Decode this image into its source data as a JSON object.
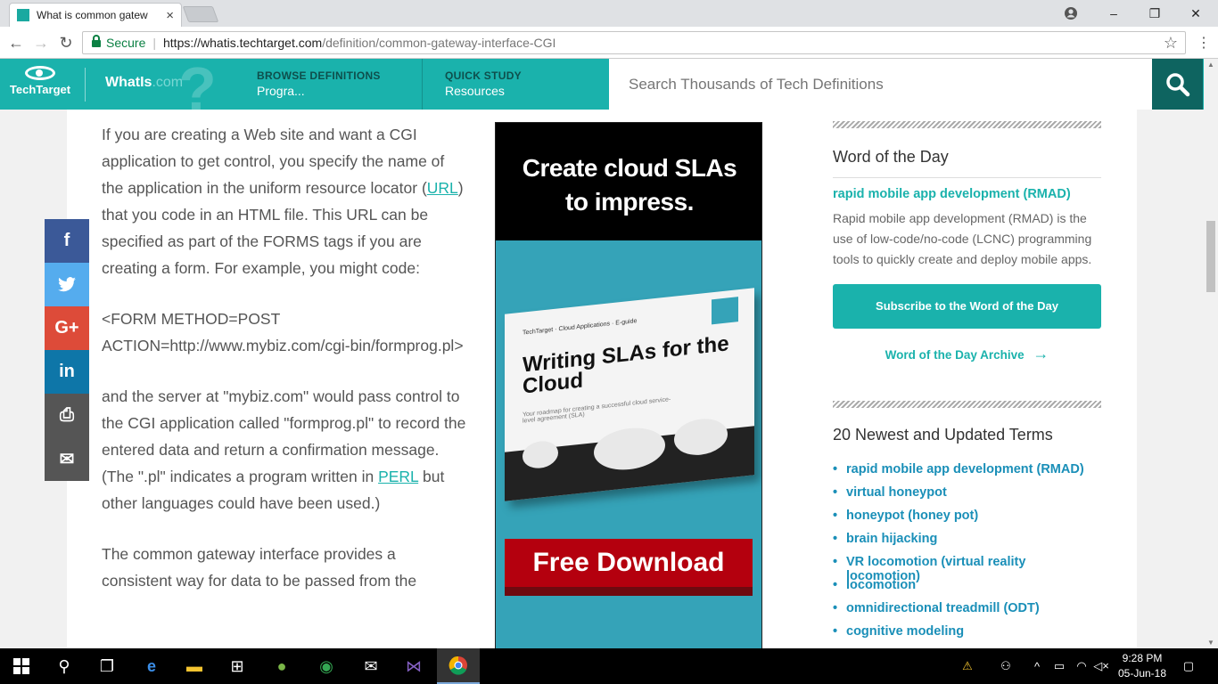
{
  "browser": {
    "tab_title": "What is common gatew",
    "tab_close": "×",
    "omnibox": {
      "secure_label": "Secure",
      "url_host": "https://whatis.techtarget.com",
      "url_path": "/definition/common-gateway-interface-CGI"
    },
    "window_controls": [
      "–",
      "❐",
      "✕"
    ]
  },
  "site": {
    "logo_text": "TechTarget",
    "brand_main": "WhatIs",
    "brand_suffix": ".com",
    "menu": [
      {
        "head": "BROWSE DEFINITIONS",
        "sub": "Progra..."
      },
      {
        "head": "QUICK STUDY",
        "sub": "Resources"
      }
    ],
    "search_placeholder": "Search Thousands of Tech Definitions"
  },
  "article": {
    "p1_a": "If you are creating a Web site and want a CGI application to get control, you specify the name of the application in the uniform resource locator (",
    "p1_link": "URL",
    "p1_b": ") that you code in an HTML file. This URL can be specified as part of the FORMS tags if you are creating a form. For example, you might code:",
    "code": "<FORM METHOD=POST ACTION=http://www.mybiz.com/cgi-bin/formprog.pl>",
    "p2_a": "and the server at \"mybiz.com\" would pass control to the CGI application called \"formprog.pl\" to record the entered data and return a confirmation message. (The \".pl\" indicates a program written in ",
    "p2_link": "PERL",
    "p2_b": " but other languages could have been used.)",
    "p3": "The common gateway interface provides a consistent way for data to be passed from the"
  },
  "share": [
    {
      "icon": "facebook-icon",
      "glyph": "f",
      "color": "#3b5998"
    },
    {
      "icon": "twitter-icon",
      "glyph": "🐦",
      "color": "#55acee"
    },
    {
      "icon": "google-plus-icon",
      "glyph": "G+",
      "color": "#dd4b39"
    },
    {
      "icon": "linkedin-icon",
      "glyph": "in",
      "color": "#0e76a8"
    },
    {
      "icon": "print-icon",
      "glyph": "⎙",
      "color": "#555555"
    },
    {
      "icon": "email-icon",
      "glyph": "✉",
      "color": "#555555"
    }
  ],
  "ad": {
    "headline": "Create cloud SLAs to impress.",
    "book_title": "Writing SLAs for the Cloud",
    "book_subtitle": "Your roadmap for creating a successful cloud service-level agreement (SLA)",
    "book_tag": "TechTarget · Cloud Applications · E-guide",
    "cta": "Free Download"
  },
  "sidebar": {
    "wotd_heading": "Word of the Day",
    "wotd_term": "rapid mobile app development (RMAD)",
    "wotd_def": "Rapid mobile app development (RMAD) is the use of low-code/no-code (LCNC) programming tools to quickly create and deploy mobile apps.",
    "subscribe_label": "Subscribe to the Word of the Day",
    "archive_label": "Word of the Day Archive",
    "newest_heading": "20 Newest and Updated Terms",
    "terms": [
      "rapid mobile app development (RMAD)",
      "virtual honeypot",
      "honeypot (honey pot)",
      "brain hijacking",
      "VR locomotion (virtual reality locomotion)",
      "locomotion",
      "omnidirectional treadmill (ODT)",
      "cognitive modeling"
    ]
  },
  "taskbar": {
    "time": "9:28 PM",
    "date": "05-Jun-18"
  },
  "colors": {
    "brand": "#1ab2ac",
    "brand_dark": "#0e6460",
    "ad_red": "#b4000e",
    "link_blue": "#1a8fb8"
  }
}
